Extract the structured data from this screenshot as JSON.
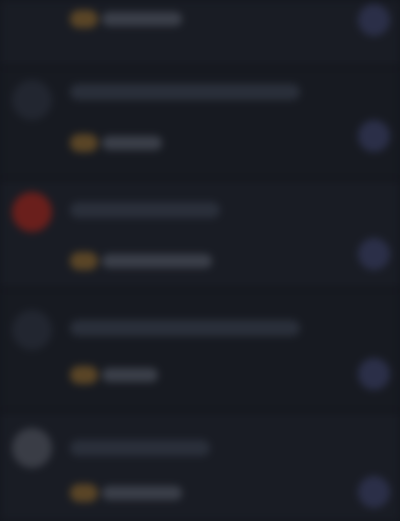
{
  "theme": {
    "background": "#161a21",
    "row": "#191c24",
    "accent_orange": "#5a4526",
    "accent_purple": "#2b2f48",
    "avatar_red": "#6a1f1c",
    "avatar_grey": "#3a3d46"
  },
  "feed": {
    "items": [
      {
        "kind": "partial-top",
        "has_avatar": false
      },
      {
        "kind": "post",
        "has_avatar": false
      },
      {
        "kind": "post",
        "avatar_color": "red"
      },
      {
        "kind": "post",
        "has_avatar": false
      },
      {
        "kind": "post",
        "avatar_color": "grey"
      }
    ]
  }
}
